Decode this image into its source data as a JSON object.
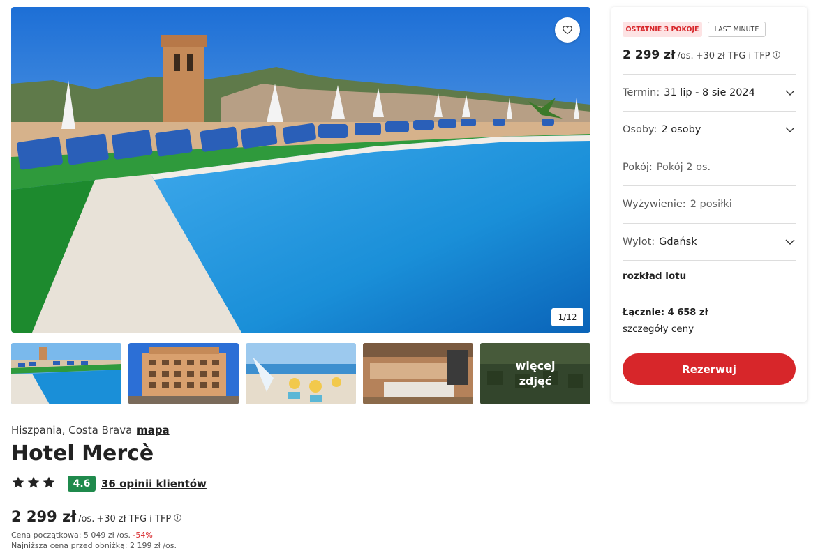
{
  "gallery": {
    "counter": "1/12",
    "more_photos_label": "więcej zdjęć",
    "favorite_icon": "heart-icon"
  },
  "hotel": {
    "location": "Hiszpania, Costa Brava",
    "map_link": "mapa",
    "name": "Hotel Mercè",
    "stars": 3,
    "rating": "4.6",
    "reviews_link": "36 opinii klientów"
  },
  "pricing": {
    "price": "2 299 zł",
    "per_person": "/os.",
    "fees": "+30 zł TFG i TFP",
    "original_price": "Cena początkowa: 5 049 zł /os.",
    "discount": "-54%",
    "lowest_price": "Najniższa cena przed obniżką: 2 199 zł /os."
  },
  "booking": {
    "badges": [
      "OSTATNIE 3 POKOJE",
      "LAST MINUTE"
    ],
    "price": "2 299 zł",
    "per_person": "/os.",
    "fees": "+30 zł TFG i TFP",
    "rows": [
      {
        "label": "Termin:",
        "value": "31 lip - 8 sie 2024",
        "dropdown": true
      },
      {
        "label": "Osoby:",
        "value": "2 osoby",
        "dropdown": true
      },
      {
        "label": "Pokój:",
        "value": "Pokój 2 os.",
        "dropdown": false
      },
      {
        "label": "Wyżywienie:",
        "value": "2 posiłki",
        "dropdown": false
      },
      {
        "label": "Wylot:",
        "value": "Gdańsk",
        "dropdown": true
      }
    ],
    "flight_link": "rozkład lotu",
    "total": "Łącznie: 4 658 zł",
    "price_details_link": "szczegóły ceny",
    "book_button": "Rezerwuj"
  },
  "colors": {
    "brand_red": "#d7262a",
    "rating_green": "#1f8a4c",
    "pool_blue": "#1a8fd8"
  }
}
